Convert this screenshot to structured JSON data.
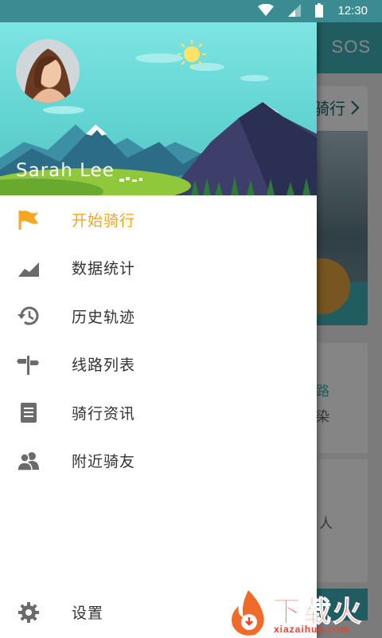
{
  "status_bar": {
    "time": "12:30"
  },
  "background_app": {
    "sos_label": "SOS",
    "card_title": "骑行",
    "card2_line1": "路",
    "card2_line2": "染",
    "card2_line3": "人"
  },
  "drawer": {
    "user_name": "Sarah Lee",
    "menu": [
      {
        "label": "开始骑行",
        "icon": "flag-icon",
        "active": true
      },
      {
        "label": "数据统计",
        "icon": "chart-icon",
        "active": false
      },
      {
        "label": "历史轨迹",
        "icon": "history-icon",
        "active": false
      },
      {
        "label": "线路列表",
        "icon": "signpost-icon",
        "active": false
      },
      {
        "label": "骑行资讯",
        "icon": "document-icon",
        "active": false
      },
      {
        "label": "附近骑友",
        "icon": "people-icon",
        "active": false
      }
    ],
    "settings_label": "设置"
  },
  "watermark": {
    "brand": "下载火",
    "site": "xiazaihuo.com"
  },
  "colors": {
    "accent": "#f5a623",
    "primary": "#40b3b9",
    "icon_gray": "#6b6b6b"
  }
}
